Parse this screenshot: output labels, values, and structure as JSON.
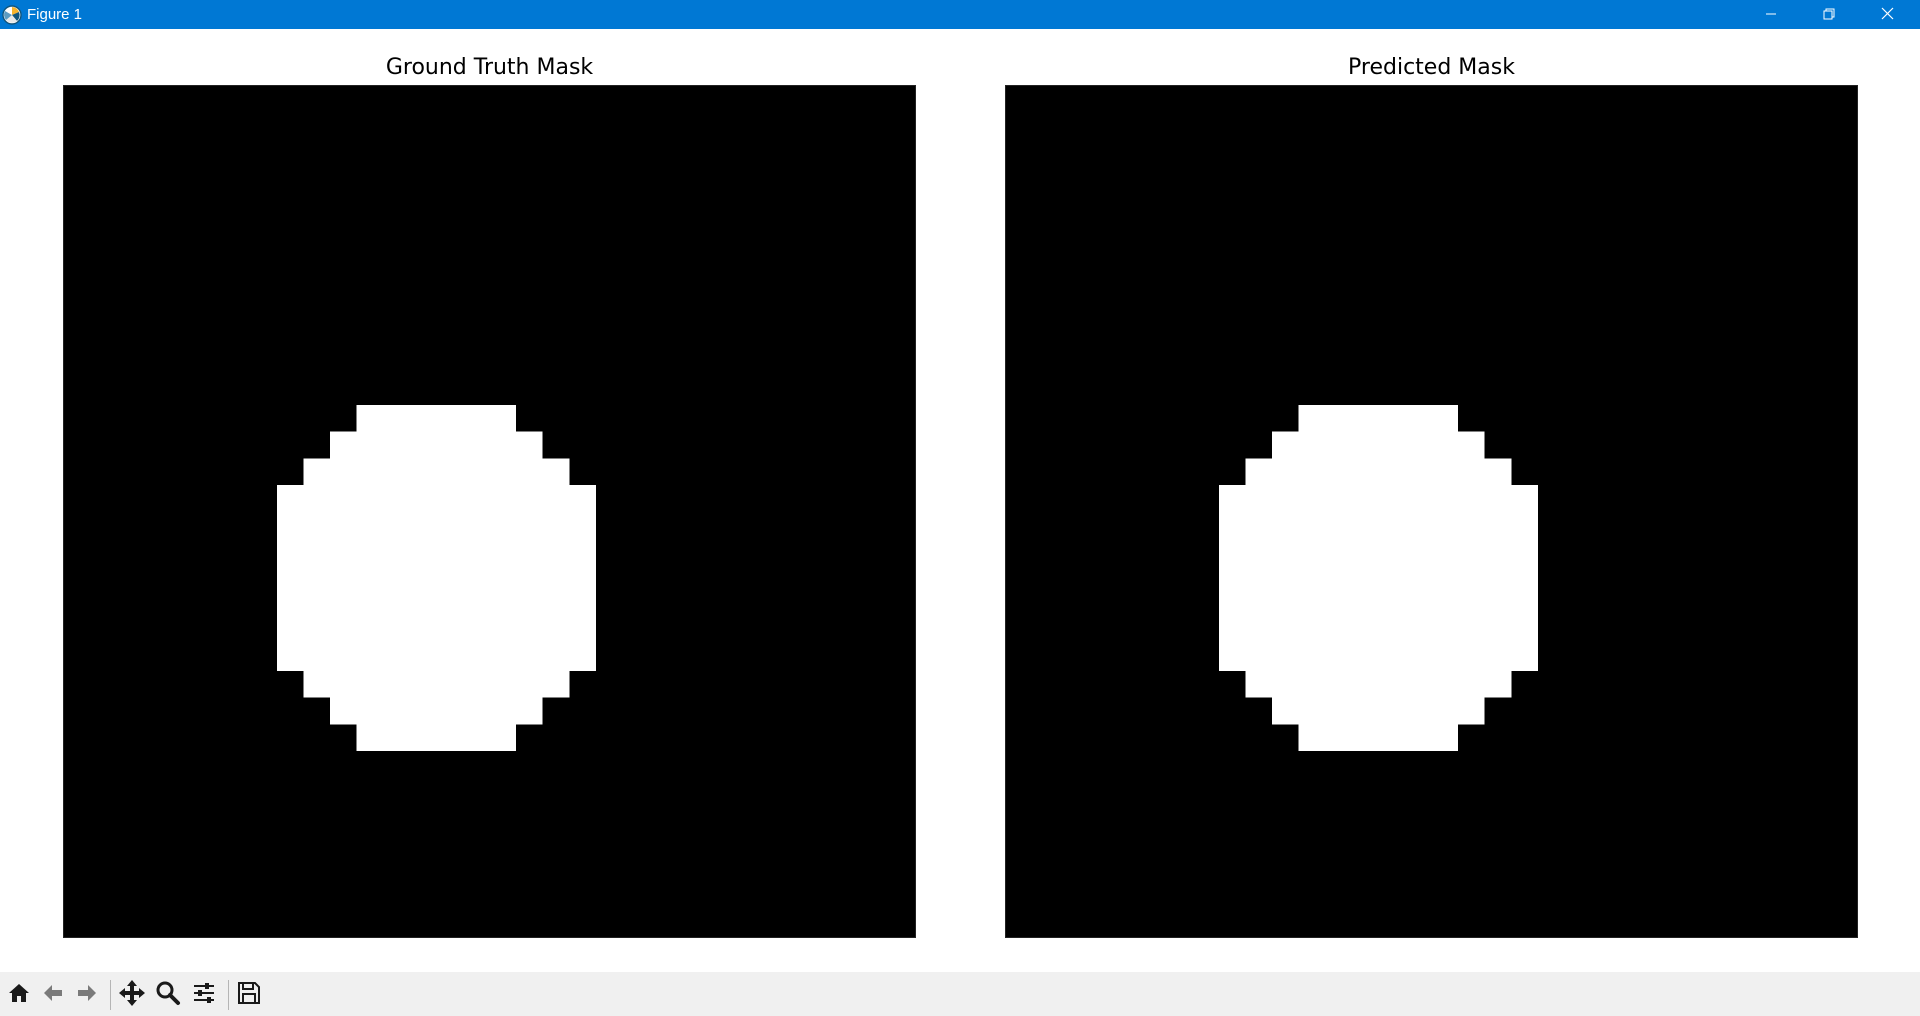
{
  "window": {
    "title": "Figure 1",
    "controls": {
      "minimize_icon": "minimize-icon",
      "restore_icon": "restore-icon",
      "close_icon": "close-icon"
    },
    "titlebar_color": "#0078d4"
  },
  "figure": {
    "subplots": [
      {
        "title": "Ground Truth Mask",
        "image": "binary-mask",
        "colormap": [
          "#000000",
          "#ffffff"
        ],
        "grid_size": 32,
        "mask_rows": [
          {
            "row": 12,
            "cols": [
              11,
              17
            ]
          },
          {
            "row": 13,
            "cols": [
              10,
              18
            ]
          },
          {
            "row": 14,
            "cols": [
              9,
              19
            ]
          },
          {
            "row": 15,
            "cols": [
              8,
              20
            ]
          },
          {
            "row": 16,
            "cols": [
              8,
              20
            ]
          },
          {
            "row": 17,
            "cols": [
              8,
              20
            ]
          },
          {
            "row": 18,
            "cols": [
              8,
              20
            ]
          },
          {
            "row": 19,
            "cols": [
              8,
              20
            ]
          },
          {
            "row": 20,
            "cols": [
              8,
              20
            ]
          },
          {
            "row": 21,
            "cols": [
              8,
              20
            ]
          },
          {
            "row": 22,
            "cols": [
              9,
              19
            ]
          },
          {
            "row": 23,
            "cols": [
              10,
              18
            ]
          },
          {
            "row": 24,
            "cols": [
              11,
              17
            ]
          }
        ]
      },
      {
        "title": "Predicted Mask",
        "image": "binary-mask",
        "colormap": [
          "#000000",
          "#ffffff"
        ],
        "grid_size": 32,
        "mask_rows": [
          {
            "row": 12,
            "cols": [
              11,
              17
            ]
          },
          {
            "row": 13,
            "cols": [
              10,
              18
            ]
          },
          {
            "row": 14,
            "cols": [
              9,
              19
            ]
          },
          {
            "row": 15,
            "cols": [
              8,
              20
            ]
          },
          {
            "row": 16,
            "cols": [
              8,
              20
            ]
          },
          {
            "row": 17,
            "cols": [
              8,
              20
            ]
          },
          {
            "row": 18,
            "cols": [
              8,
              20
            ]
          },
          {
            "row": 19,
            "cols": [
              8,
              20
            ]
          },
          {
            "row": 20,
            "cols": [
              8,
              20
            ]
          },
          {
            "row": 21,
            "cols": [
              8,
              20
            ]
          },
          {
            "row": 22,
            "cols": [
              9,
              19
            ]
          },
          {
            "row": 23,
            "cols": [
              10,
              18
            ]
          },
          {
            "row": 24,
            "cols": [
              11,
              17
            ]
          }
        ]
      }
    ]
  },
  "toolbar": {
    "tools": [
      {
        "name": "home-icon",
        "tooltip": "Reset original view"
      },
      {
        "name": "back-icon",
        "tooltip": "Back to previous view"
      },
      {
        "name": "forward-icon",
        "tooltip": "Forward to next view"
      },
      {
        "name": "pan-icon",
        "tooltip": "Pan axes"
      },
      {
        "name": "zoom-icon",
        "tooltip": "Zoom to rectangle"
      },
      {
        "name": "configure-subplots-icon",
        "tooltip": "Configure subplots"
      },
      {
        "name": "save-icon",
        "tooltip": "Save the figure"
      }
    ]
  }
}
